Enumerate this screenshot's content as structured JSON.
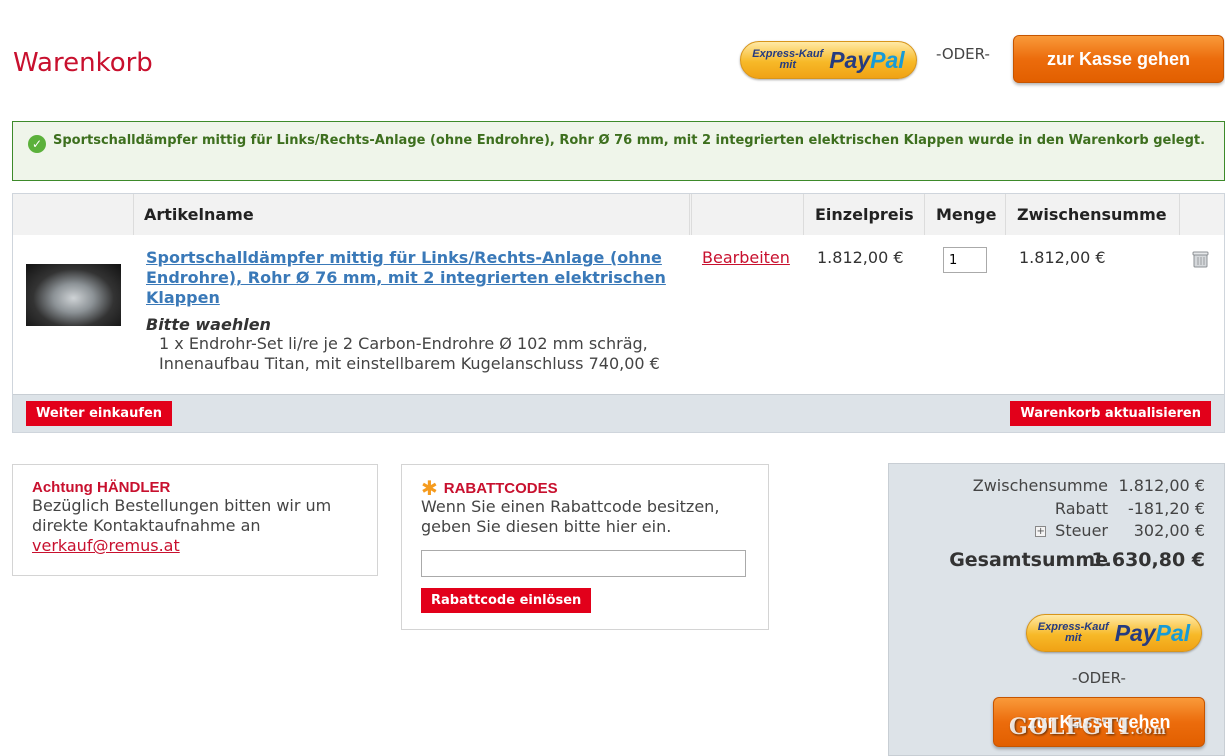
{
  "page_title": "Warenkorb",
  "top": {
    "paypal": {
      "small_line1": "Express-Kauf",
      "small_line2": "mit",
      "logo_pay": "Pay",
      "logo_pal": "Pal"
    },
    "oder": "-ODER-",
    "checkout_label": "zur Kasse gehen"
  },
  "success_message": "Sportschalldämpfer mittig für Links/Rechts-Anlage (ohne Endrohre), Rohr Ø 76 mm, mit 2 integrierten elektrischen Klappen wurde in den Warenkorb gelegt.",
  "cart": {
    "headers": {
      "image": "",
      "name": "Artikelname",
      "edit": "",
      "price": "Einzelpreis",
      "qty": "Menge",
      "subtotal": "Zwischensumme",
      "remove": ""
    },
    "items": [
      {
        "name": "Sportschalldämpfer mittig für Links/Rechts-Anlage (ohne Endrohre), Rohr Ø 76 mm, mit 2 integrierten elektrischen Klappen",
        "option_title": "Bitte waehlen",
        "option_value": "1 x Endrohr-Set li/re je 2 Carbon-Endrohre Ø 102 mm schräg, Innenaufbau Titan, mit einstellbarem Kugelanschluss 740,00 €",
        "edit_label": "Bearbeiten",
        "unit_price": "1.812,00 €",
        "qty": "1",
        "subtotal": "1.812,00 €"
      }
    ],
    "continue_label": "Weiter einkaufen",
    "update_label": "Warenkorb aktualisieren"
  },
  "dealer": {
    "title": "Achtung HÄNDLER",
    "text": "Bezüglich Bestellungen bitten wir um direkte Kontaktaufnahme an",
    "email": "verkauf@remus.at"
  },
  "coupon": {
    "title": "RABATTCODES",
    "text": "Wenn Sie einen Rabattcode besitzen, geben Sie diesen bitte hier ein.",
    "input_value": "",
    "button_label": "Rabattcode einlösen"
  },
  "totals": {
    "subtotal_label": "Zwischensumme",
    "subtotal_value": "1.812,00 €",
    "discount_label": "Rabatt",
    "discount_value": "-181,20 €",
    "tax_label": "Steuer",
    "tax_value": "302,00 €",
    "grand_label": "Gesamtsumme",
    "grand_value": "1.630,80 €",
    "oder": "-ODER-",
    "checkout_label": "zur Kasse gehen"
  },
  "watermark": {
    "main": "GOLF",
    "mid": "GTI",
    "suffix": ".com"
  },
  "colors": {
    "brand_red": "#c8102e",
    "button_red": "#e2001a",
    "checkout_orange": "#ec6c0c",
    "link_blue": "#3a79b8",
    "success_green": "#3d6f1e"
  }
}
